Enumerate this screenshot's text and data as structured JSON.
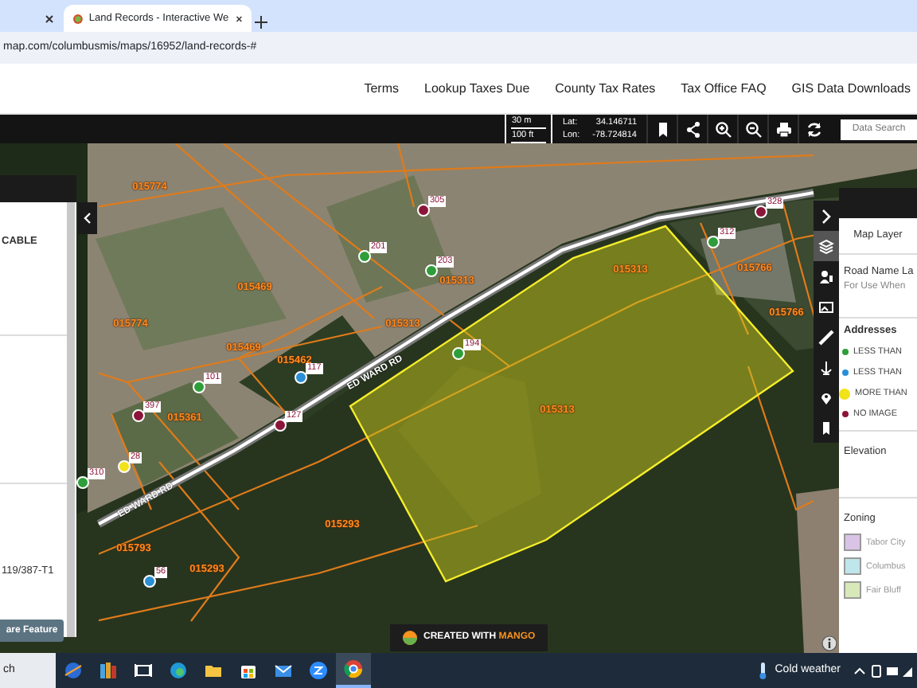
{
  "browser": {
    "tabs": [
      {
        "selected": false
      },
      {
        "title": "Land Records - Interactive We",
        "selected": true
      }
    ],
    "url": "map.com/columbusmis/maps/16952/land-records-#"
  },
  "nav_links": [
    "Terms",
    "Lookup Taxes Due",
    "County Tax Rates",
    "Tax Office FAQ",
    "GIS Data Downloads"
  ],
  "toolbar": {
    "scale": [
      "30 m",
      "100 ft"
    ],
    "lat_label": "Lat:",
    "lat": "34.146711",
    "lon_label": "Lon:",
    "lon": "-78.724814",
    "search": {
      "placeholder": "Data Search"
    }
  },
  "left_panel": {
    "texts": [
      "CABLE",
      "119/387-T1"
    ],
    "button": "are Feature"
  },
  "map": {
    "parcel_labels": [
      "015774",
      "015774",
      "015469",
      "015469",
      "015462",
      "015361",
      "015793",
      "015293",
      "015293",
      "015313",
      "015313",
      "015313",
      "015313",
      "015766",
      "015766"
    ],
    "road_labels": [
      "ED WARD RD",
      "ED WARD RD"
    ],
    "markers": [
      {
        "number": "101",
        "color": "#2e9e3a"
      },
      {
        "number": "397",
        "color": "#8b1538"
      },
      {
        "number": "28",
        "color": "#f2e21a"
      },
      {
        "number": "310",
        "color": "#2e9e3a"
      },
      {
        "number": "117",
        "color": "#2a8fd6"
      },
      {
        "number": "127",
        "color": "#8b1538"
      },
      {
        "number": "56",
        "color": "#2a8fd6"
      },
      {
        "number": "305",
        "color": "#8b1538"
      },
      {
        "number": "201",
        "color": "#2e9e3a"
      },
      {
        "number": "203",
        "color": "#2e9e3a"
      },
      {
        "number": "194",
        "color": "#2e9e3a"
      },
      {
        "number": "312",
        "color": "#2e9e3a"
      },
      {
        "number": "328",
        "color": "#8b1538"
      }
    ],
    "side_tools": [
      {
        "kind": "collapse",
        "selected": false
      },
      {
        "kind": "layers",
        "selected": true
      },
      {
        "kind": "person",
        "selected": false
      },
      {
        "kind": "card",
        "selected": false
      },
      {
        "kind": "ruler",
        "selected": false
      },
      {
        "kind": "anchor",
        "selected": false
      },
      {
        "kind": "pin",
        "selected": false
      },
      {
        "kind": "bookmark",
        "selected": false
      }
    ],
    "badge": {
      "prefix": "CREATED WITH",
      "brand": "MANGO"
    }
  },
  "right_panel": {
    "title": "Map Layer",
    "road_layer": {
      "title": "Road Name La",
      "subtitle": "For Use When"
    },
    "addresses": {
      "title": "Addresses",
      "legend": [
        {
          "label": "LESS THAN",
          "color": "#2e9e3a"
        },
        {
          "label": "LESS THAN",
          "color": "#2a8fd6"
        },
        {
          "label": "MORE THAN",
          "color": "#f2e21a"
        },
        {
          "label": "NO IMAGE",
          "color": "#8b1538"
        }
      ]
    },
    "elevation": {
      "title": "Elevation"
    },
    "zoning": {
      "title": "Zoning",
      "legend": [
        {
          "label": "Tabor City",
          "color": "#d9c3e6"
        },
        {
          "label": "Columbus",
          "color": "#bfe6ea"
        },
        {
          "label": "Fair Bluff",
          "color": "#d8e8b8"
        }
      ]
    }
  },
  "taskbar": {
    "search": "ch",
    "apps": [
      {
        "kind": "globe",
        "selected": false
      },
      {
        "kind": "books",
        "selected": false
      },
      {
        "kind": "taskview",
        "selected": false
      },
      {
        "kind": "edge",
        "selected": false
      },
      {
        "kind": "folder",
        "selected": false
      },
      {
        "kind": "store",
        "selected": false
      },
      {
        "kind": "mail",
        "selected": false
      },
      {
        "kind": "zoom",
        "selected": false
      },
      {
        "kind": "chrome",
        "selected": true
      }
    ],
    "weather": "Cold weather"
  }
}
